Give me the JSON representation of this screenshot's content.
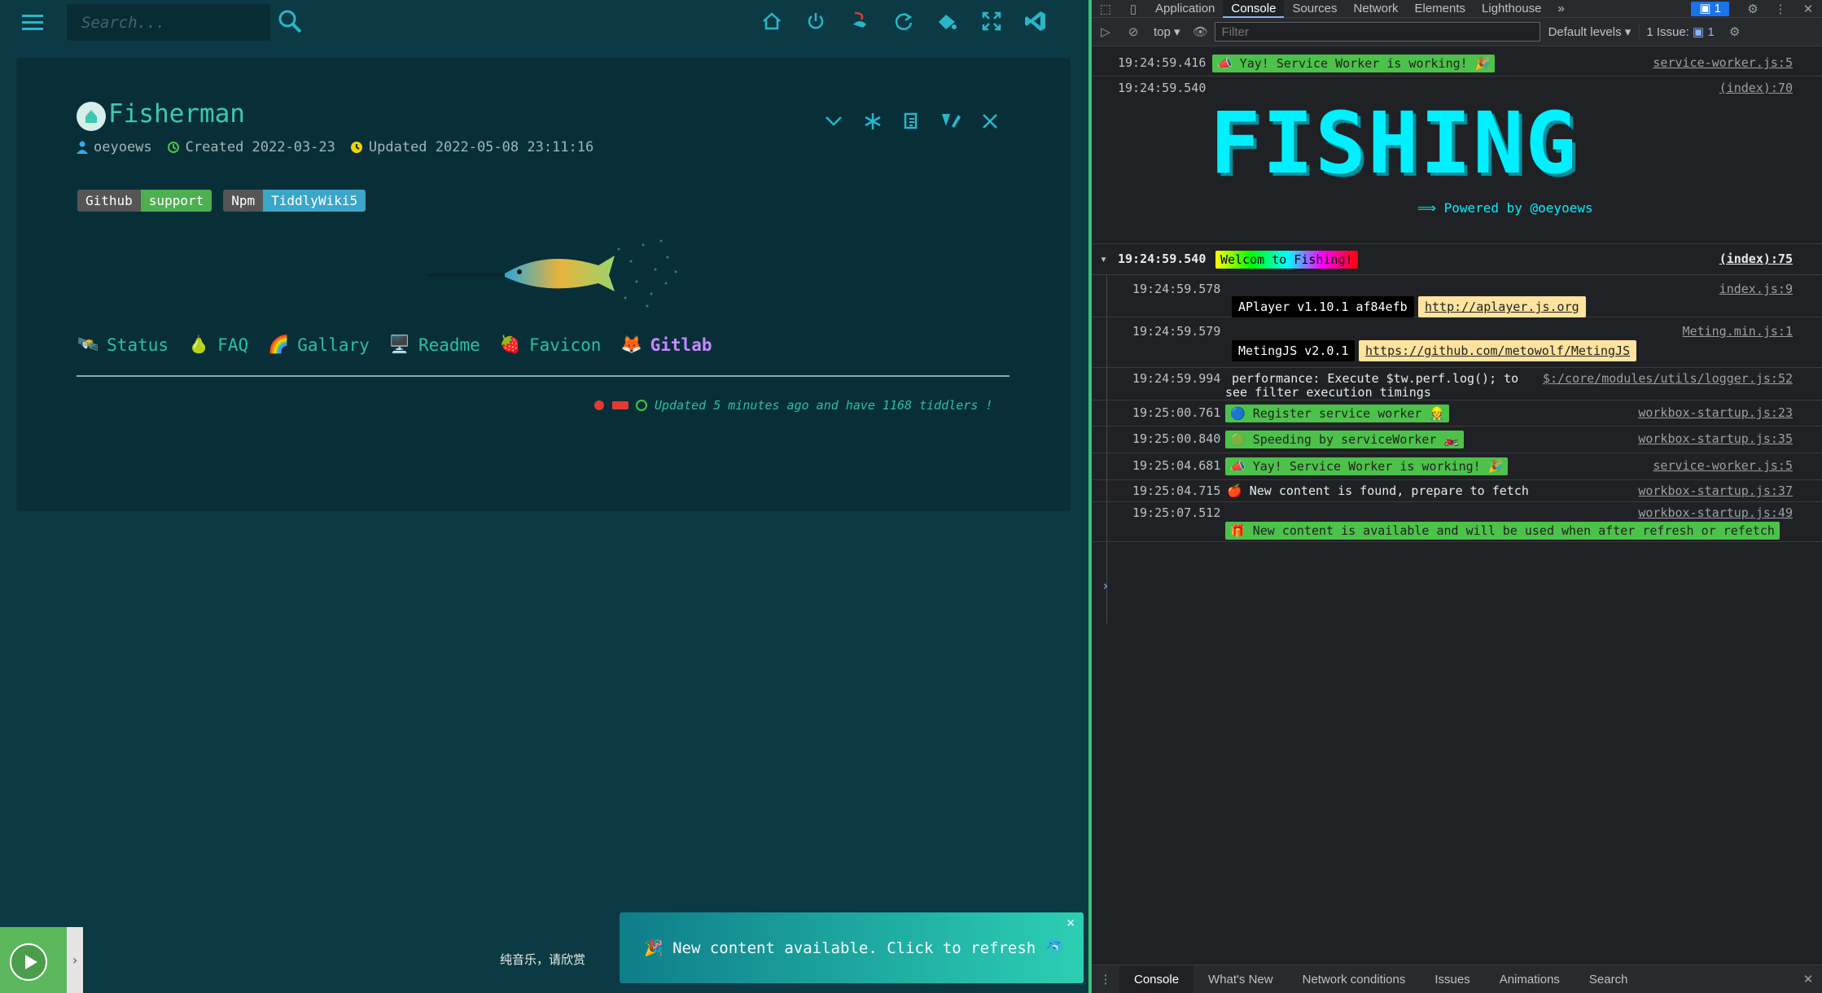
{
  "search": {
    "placeholder": "Search..."
  },
  "tiddler": {
    "title": "Fisherman",
    "author": "oeyoews",
    "created": "Created 2022-03-23",
    "updated": "Updated 2022-05-08 23:11:16",
    "badges": [
      {
        "left": "Github",
        "right": "support"
      },
      {
        "left": "Npm",
        "right": "TiddlyWiki5"
      }
    ],
    "nav": [
      {
        "emoji": "🛰️",
        "label": "Status"
      },
      {
        "emoji": "🍐",
        "label": "FAQ"
      },
      {
        "emoji": "🌈",
        "label": "Gallary"
      },
      {
        "emoji": "🖥️",
        "label": "Readme"
      },
      {
        "emoji": "🍓",
        "label": "Favicon"
      },
      {
        "emoji": "🦊",
        "label": "Gitlab"
      }
    ],
    "status_line": "Updated 5 minutes ago and have 1168 tiddlers !"
  },
  "player": {
    "lyric": "纯音乐，请欣赏",
    "arrow": "›"
  },
  "toast": {
    "text": "🎉 New content available. Click to refresh 🐬",
    "close": "×"
  },
  "devtools": {
    "tabs": [
      "Application",
      "Console",
      "Sources",
      "Network",
      "Elements",
      "Lighthouse"
    ],
    "more": "»",
    "msg_count": "1",
    "context": "top",
    "filter_placeholder": "Filter",
    "levels": "Default levels",
    "issues": "1 Issue:",
    "issues_count": "1",
    "banner_line": "⟹ Powered by @oeyoews",
    "banner_word": "FISHING",
    "logs": [
      {
        "ts": "19:24:59.416",
        "text": "📣 Yay! Service Worker is working! 🎉",
        "src": "service-worker.js:5"
      },
      {
        "ts": "19:24:59.540",
        "text": "",
        "src": "(index):70"
      },
      {
        "ts": "19:24:59.540",
        "text": "Welcom to Fishing!",
        "src": "(index):75"
      },
      {
        "ts": "19:24:59.578",
        "text": "APlayer v1.10.1 af84efb",
        "link": "http://aplayer.js.org",
        "src": "index.js:9"
      },
      {
        "ts": "19:24:59.579",
        "text": "MetingJS v2.0.1",
        "link": "https://github.com/metowolf/MetingJS",
        "src": "Meting.min.js:1"
      },
      {
        "ts": "19:24:59.994",
        "text": "performance: Execute $tw.perf.log(); to",
        "text2": "see filter execution timings",
        "src": "$:/core/modules/utils/logger.js:52"
      },
      {
        "ts": "19:25:00.761",
        "text": "🔵 Register service worker 👷",
        "src": "workbox-startup.js:23"
      },
      {
        "ts": "19:25:00.840",
        "text": "🟢 Speeding by serviceWorker 🏍️",
        "src": "workbox-startup.js:35"
      },
      {
        "ts": "19:25:04.681",
        "text": "📣 Yay! Service Worker is working! 🎉",
        "src": "service-worker.js:5"
      },
      {
        "ts": "19:25:04.715",
        "text": "🍎 New content is found, prepare to fetch",
        "src": "workbox-startup.js:37"
      },
      {
        "ts": "19:25:07.512",
        "text": "🎁 New content is available and will be used when after refresh or refetch",
        "src": "workbox-startup.js:49"
      }
    ],
    "prompt": "›",
    "drawer_tabs": [
      "Console",
      "What's New",
      "Network conditions",
      "Issues",
      "Animations",
      "Search"
    ]
  }
}
